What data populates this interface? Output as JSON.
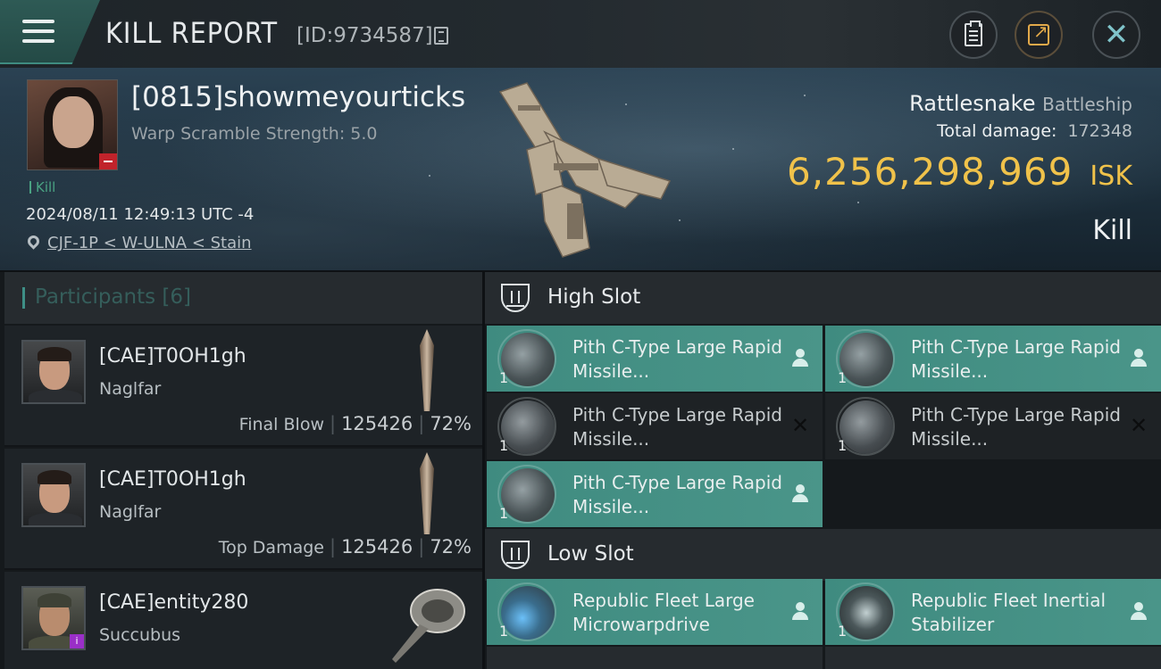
{
  "header": {
    "title": "KILL REPORT",
    "report_id": "[ID:9734587]"
  },
  "victim": {
    "name": "[0815]showmeyourticks",
    "warp_scramble": "Warp Scramble Strength: 5.0",
    "tag": "Kill",
    "datetime": "2024/08/11 12:49:13 UTC -4",
    "location": "CJF-1P < W-ULNA < Stain",
    "ship_name": "Rattlesnake",
    "ship_class": "Battleship",
    "total_damage_label": "Total damage:",
    "total_damage": "172348",
    "isk_value": "6,256,298,969",
    "isk_unit": "ISK",
    "result": "Kill"
  },
  "participants": {
    "label": "Participants [6]",
    "rows": [
      {
        "name": "[CAE]T0OH1gh",
        "ship": "Naglfar",
        "role": "Final Blow",
        "damage": "125426",
        "percent": "72%"
      },
      {
        "name": "[CAE]T0OH1gh",
        "ship": "Naglfar",
        "role": "Top Damage",
        "damage": "125426",
        "percent": "72%"
      },
      {
        "name": "[CAE]entity280",
        "ship": "Succubus",
        "role": "",
        "damage": "",
        "percent": ""
      }
    ]
  },
  "slots": {
    "high": {
      "title": "High Slot",
      "modules": [
        {
          "name": "Pith C-Type Large Rapid Missile...",
          "qty": "1",
          "status": "dropped"
        },
        {
          "name": "Pith C-Type Large Rapid Missile...",
          "qty": "1",
          "status": "dropped"
        },
        {
          "name": "Pith C-Type Large Rapid Missile...",
          "qty": "1",
          "status": "destroyed"
        },
        {
          "name": "Pith C-Type Large Rapid Missile...",
          "qty": "1",
          "status": "destroyed"
        },
        {
          "name": "Pith C-Type Large Rapid Missile...",
          "qty": "1",
          "status": "dropped"
        }
      ]
    },
    "low": {
      "title": "Low Slot",
      "modules": [
        {
          "name": "Republic Fleet Large Microwarpdrive",
          "qty": "1",
          "status": "dropped"
        },
        {
          "name": "Republic Fleet Inertial Stabilizer",
          "qty": "1",
          "status": "dropped"
        }
      ]
    }
  },
  "colors": {
    "accent": "#3f8b80",
    "isk": "#f0c24a",
    "kill_tag": "#4aa383",
    "loss_badge": "#c1232b"
  },
  "icons": [
    "menu-icon",
    "copy-icon",
    "clipboard-icon",
    "share-icon",
    "close-icon",
    "location-pin-icon",
    "slot-icon",
    "person-icon",
    "x-icon"
  ]
}
